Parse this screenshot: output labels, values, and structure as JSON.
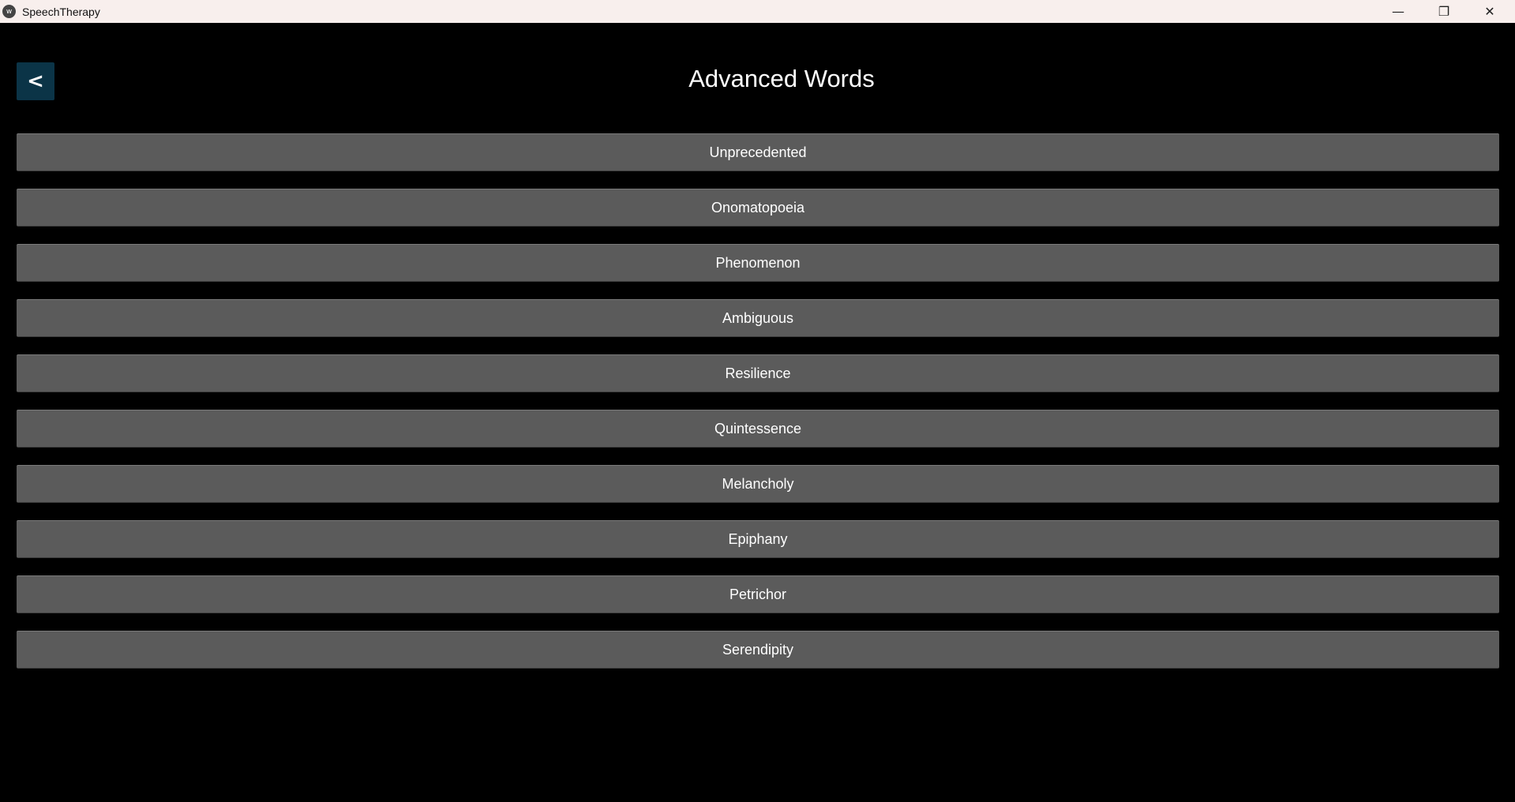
{
  "window": {
    "title": "SpeechTherapy",
    "minimize_icon": "minimize-icon",
    "restore_icon": "restore-icon",
    "close_icon": "close-icon"
  },
  "header": {
    "back_label": "<",
    "title": "Advanced Words"
  },
  "words": [
    "Unprecedented",
    "Onomatopoeia",
    "Phenomenon",
    "Ambiguous",
    "Resilience",
    "Quintessence",
    "Melancholy",
    "Epiphany",
    "Petrichor",
    "Serendipity"
  ]
}
